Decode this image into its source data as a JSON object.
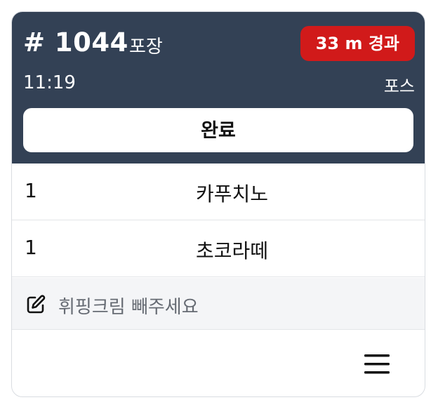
{
  "order": {
    "number": "# 1044",
    "type": "포장",
    "elapsed": "33 m 경과",
    "time": "11:19",
    "source": "포스",
    "done_label": "완료"
  },
  "items": [
    {
      "qty": "1",
      "name": "카푸치노"
    },
    {
      "qty": "1",
      "name": "초코라떼"
    }
  ],
  "note": {
    "icon": "edit-note-icon",
    "text": "휘핑크림 빼주세요"
  },
  "footer": {
    "menu_icon": "hamburger-menu-icon"
  },
  "colors": {
    "header_bg": "#334155",
    "badge_bg": "#d11a1a",
    "note_bg": "#f4f5f7"
  }
}
